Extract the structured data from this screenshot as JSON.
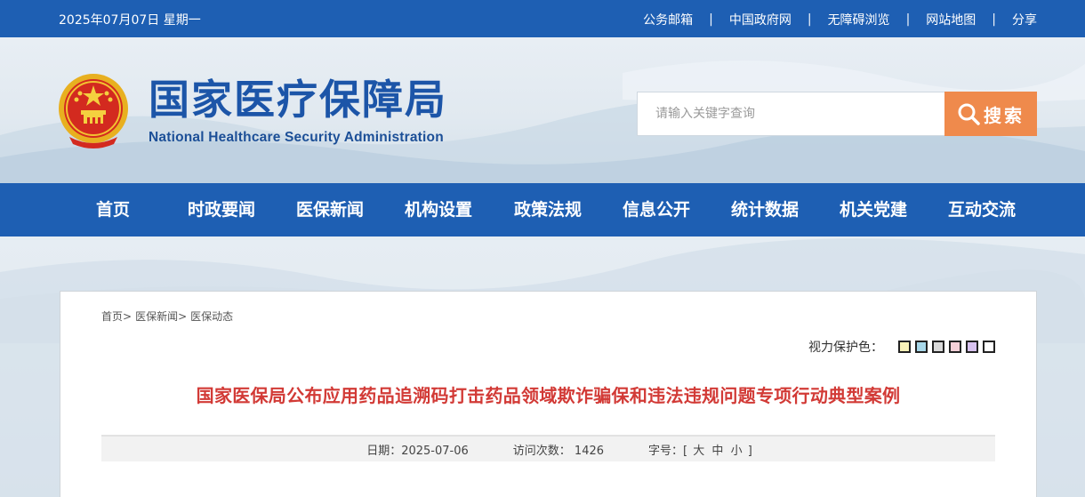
{
  "topbar": {
    "date": "2025年07月07日 星期一",
    "links": [
      "公务邮箱",
      "中国政府网",
      "无障碍浏览",
      "网站地图",
      "分享"
    ],
    "separator": "|"
  },
  "header": {
    "emblem_icon": "national-emblem-icon",
    "title_cn": "国家医疗保障局",
    "title_en": "National Healthcare Security Administration",
    "search_placeholder": "请输入关键字查询",
    "search_label": "搜索",
    "search_icon": "search-icon"
  },
  "nav": {
    "items": [
      "首页",
      "时政要闻",
      "医保新闻",
      "机构设置",
      "政策法规",
      "信息公开",
      "统计数据",
      "机关党建",
      "互动交流"
    ]
  },
  "breadcrumb": {
    "items": [
      "首页>",
      "医保新闻>",
      "医保动态"
    ]
  },
  "vision": {
    "label": "视力保护色：",
    "swatches": [
      "#f9f2b8",
      "#a8d8ea",
      "#d9d9d9",
      "#f5d0d8",
      "#d8c2f0",
      "#ffffff"
    ]
  },
  "article": {
    "title": "国家医保局公布应用药品追溯码打击药品领域欺诈骗保和违法违规问题专项行动典型案例",
    "date_label": "日期：",
    "date": "2025-07-06",
    "visits_label": "访问次数：",
    "visits": "1426",
    "font_label": "字号：",
    "font_open": "[",
    "font_sizes": [
      "大",
      "中",
      "小"
    ],
    "font_close": "]"
  },
  "colors": {
    "primary_blue": "#1e5fb3",
    "search_orange": "#ef8a4c",
    "title_red": "#d23a36"
  }
}
